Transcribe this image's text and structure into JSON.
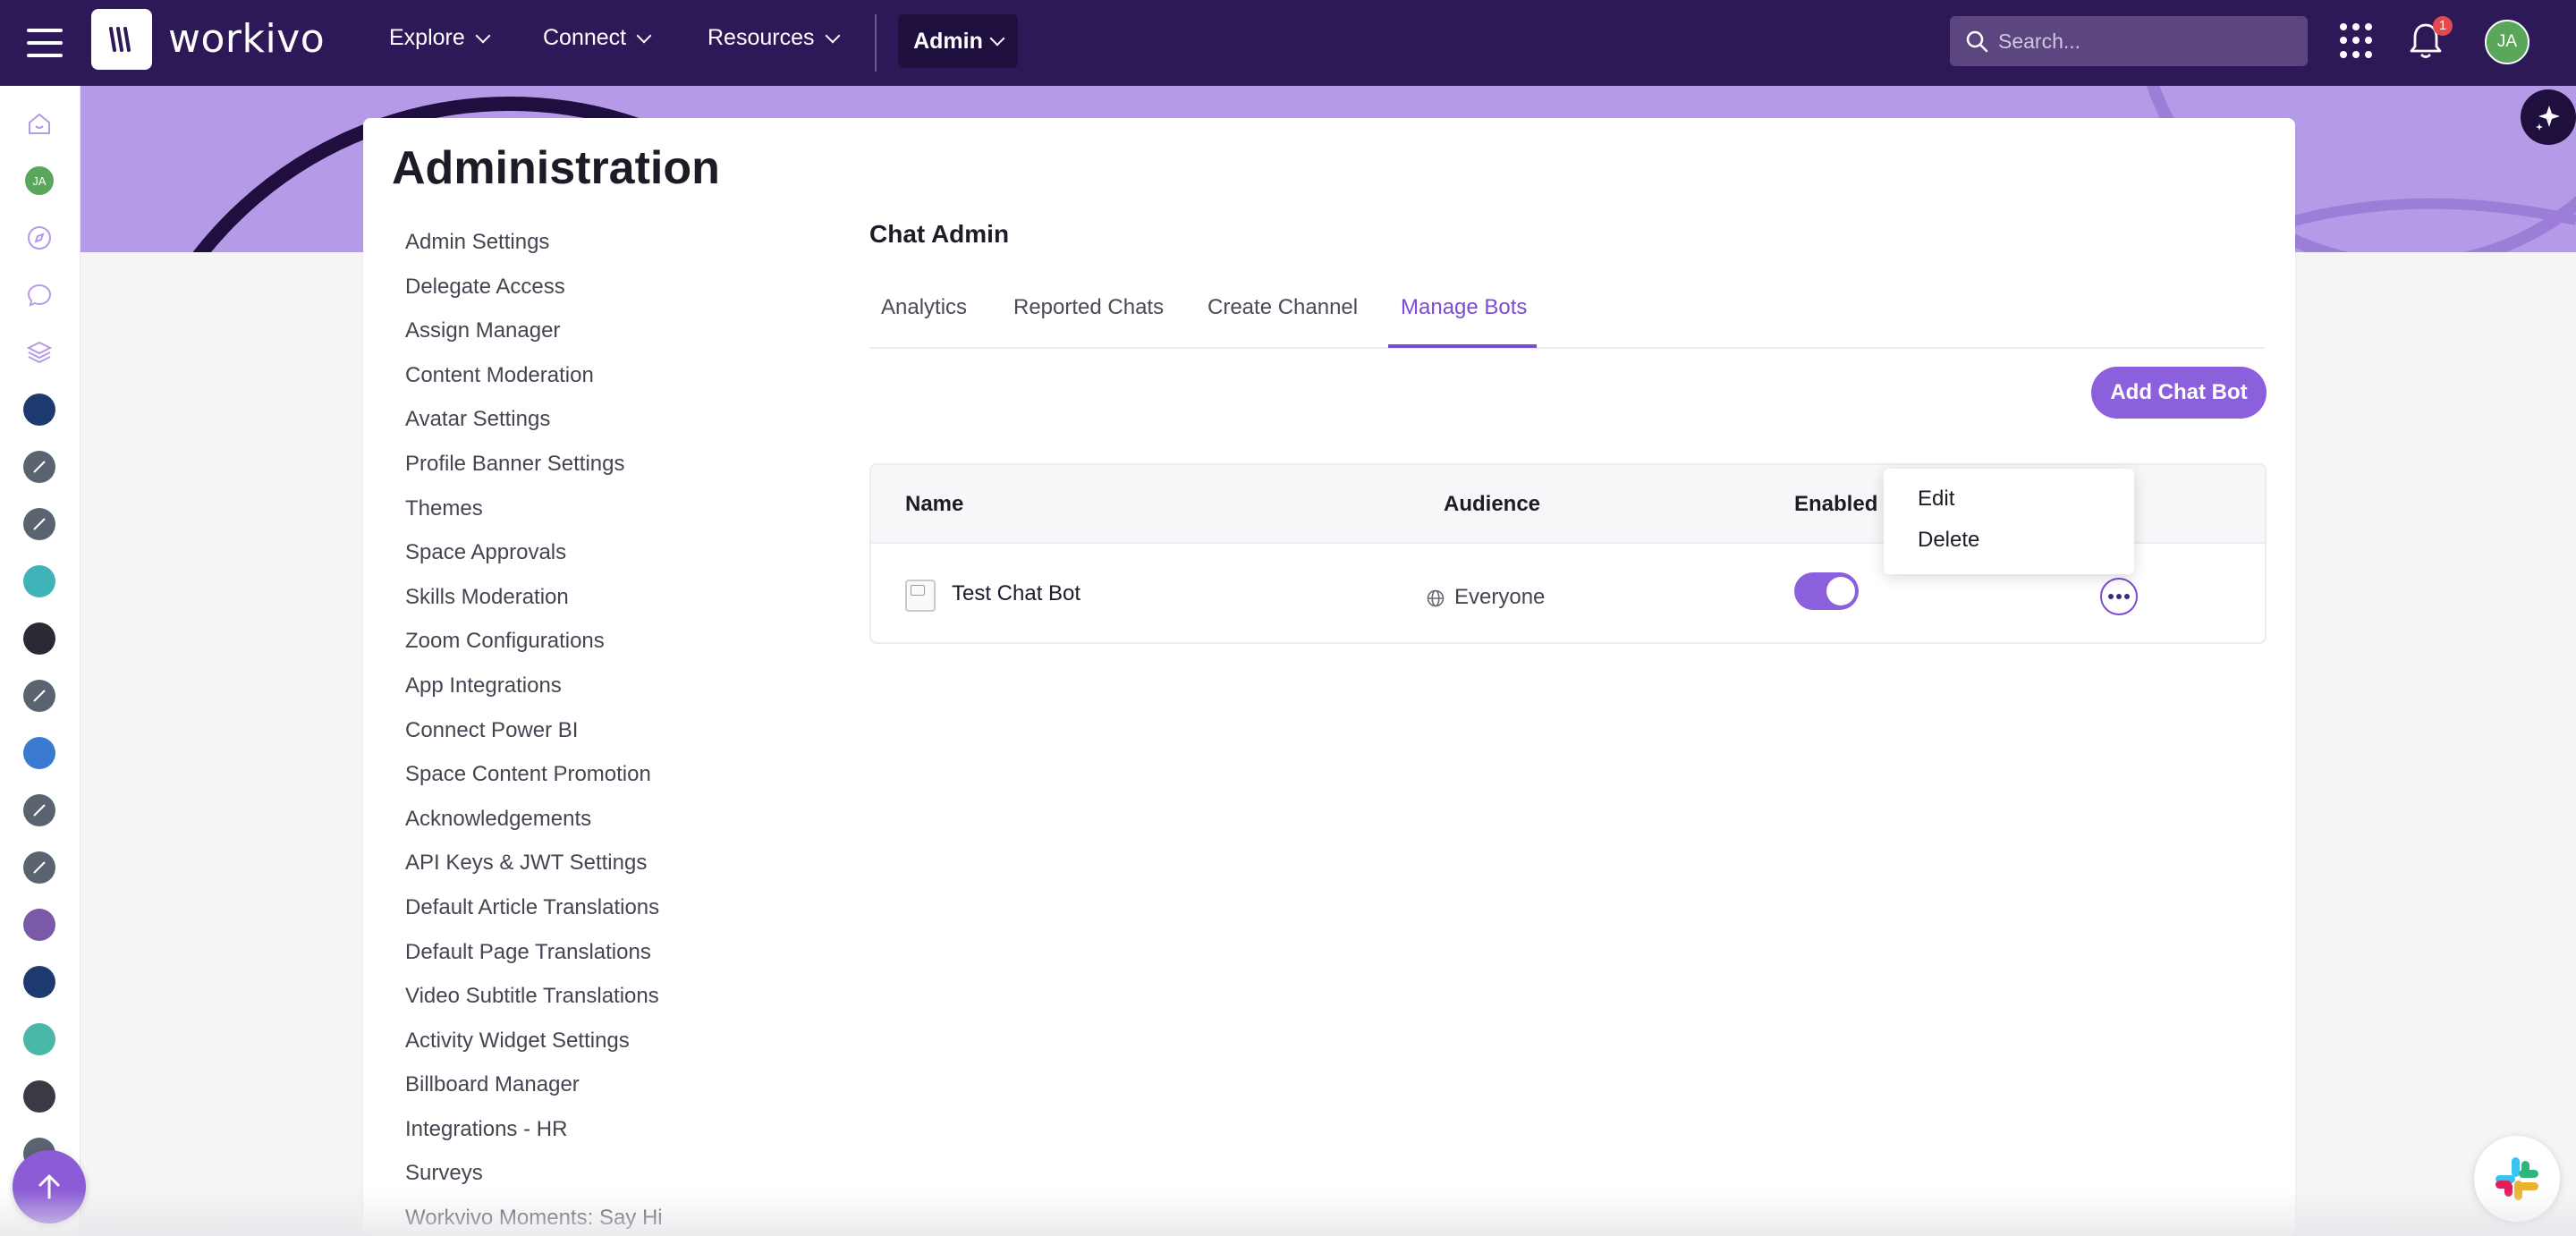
{
  "app": {
    "name": "workivo"
  },
  "topbar": {
    "nav": [
      {
        "label": "Explore"
      },
      {
        "label": "Connect"
      },
      {
        "label": "Resources"
      }
    ],
    "admin_label": "Admin",
    "search_placeholder": "Search...",
    "notification_count": "1",
    "avatar_initials": "JA"
  },
  "sidebar": {
    "avatar_initials": "JA"
  },
  "page": {
    "title": "Administration",
    "menu": [
      "Admin Settings",
      "Delegate Access",
      "Assign Manager",
      "Content Moderation",
      "Avatar Settings",
      "Profile Banner Settings",
      "Themes",
      "Space Approvals",
      "Skills Moderation",
      "Zoom Configurations",
      "App Integrations",
      "Connect Power BI",
      "Space Content Promotion",
      "Acknowledgements",
      "API Keys & JWT Settings",
      "Default Article Translations",
      "Default Page Translations",
      "Video Subtitle Translations",
      "Activity Widget Settings",
      "Billboard Manager",
      "Integrations - HR",
      "Surveys",
      "Workvivo Moments: Say Hi"
    ]
  },
  "chat_admin": {
    "title": "Chat Admin",
    "tabs": [
      "Analytics",
      "Reported Chats",
      "Create Channel",
      "Manage Bots"
    ],
    "active_tab": "Manage Bots",
    "add_button": "Add Chat Bot",
    "table": {
      "columns": [
        "Name",
        "Audience",
        "Enabled"
      ],
      "rows": [
        {
          "name": "Test Chat Bot",
          "audience": "Everyone",
          "enabled": true
        }
      ]
    },
    "row_menu": [
      "Edit",
      "Delete"
    ]
  },
  "colors": {
    "topbar": "#2d1958",
    "accent": "#8c5fdc",
    "banner": "#b59ae8"
  }
}
